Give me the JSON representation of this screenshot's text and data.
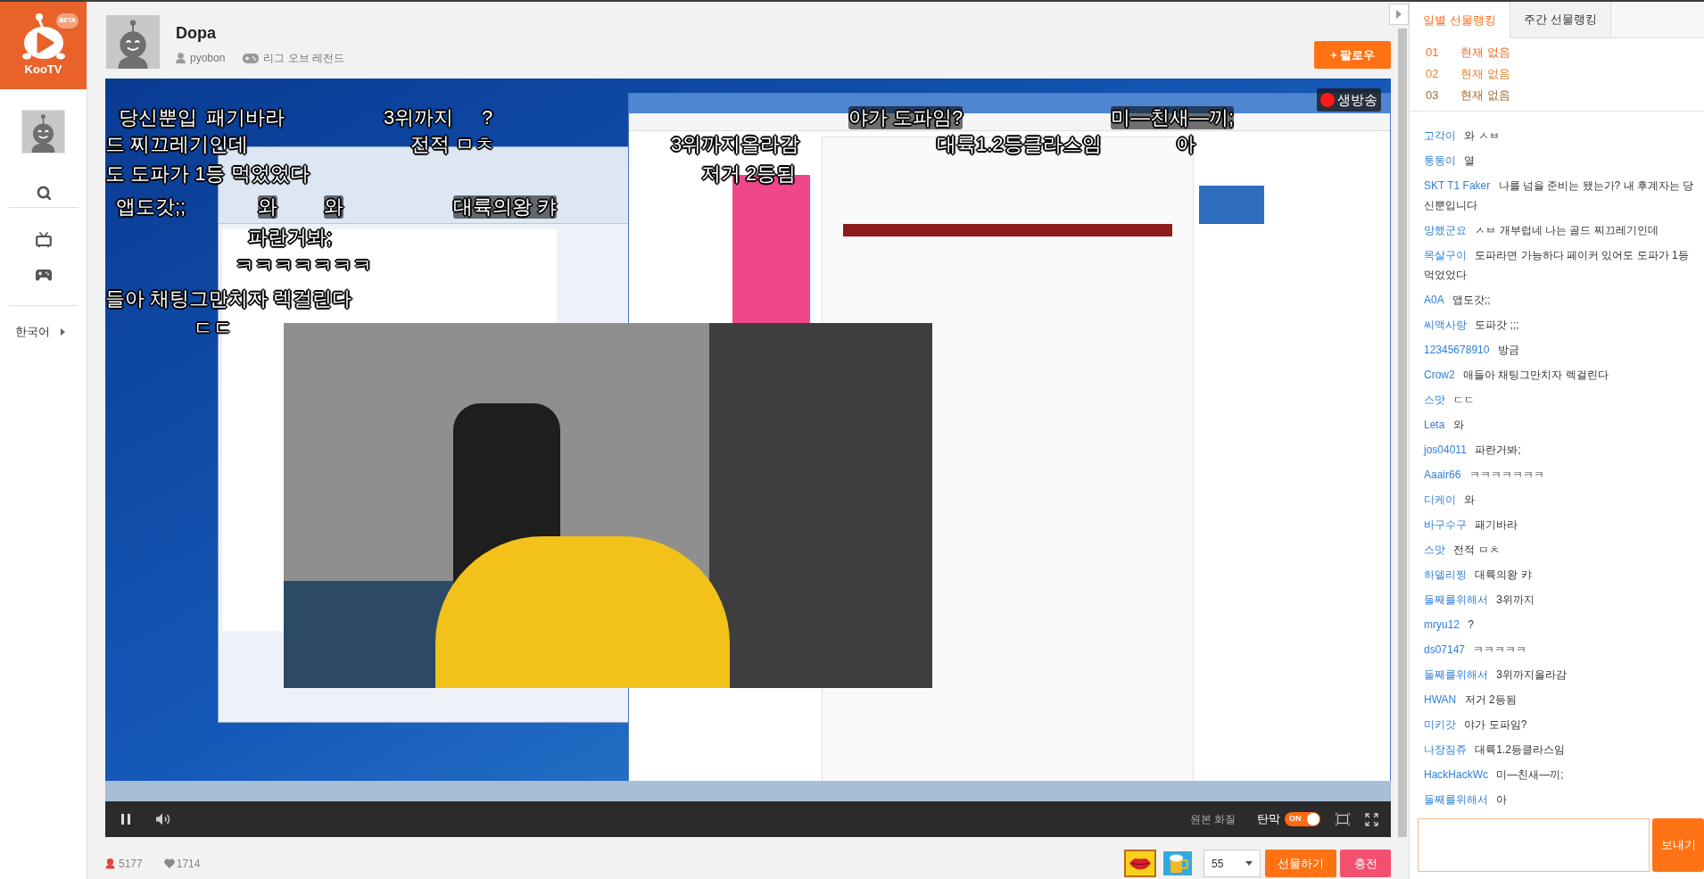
{
  "logo": {
    "name": "KooTV",
    "badge": "BETA"
  },
  "sidebar": {
    "language": "한국어"
  },
  "channel": {
    "name": "Dopa",
    "user": "pyobon",
    "game": "리그 오브 레전드",
    "follow_button": "+ 팔로우"
  },
  "player": {
    "live_badge": "생방송",
    "danmaku": [
      "당신뿐입",
      "패기바라",
      "3위까지",
      "?",
      "야가 도파임?",
      "미—친새—끼;",
      "드 찌끄레기인데",
      "전적 ㅁㅊ",
      "3위까지올라감",
      "대륙1.2등클라스임",
      "아",
      "도 도파가 1등 먹었었다",
      "저거 2등됨",
      "앱도갓;;",
      "와",
      "와",
      "대륙의왕 캬",
      "파란거봐;",
      "ㅋㅋㅋㅋㅋㅋㅋ",
      "들아 채팅그만치자 렉걸린다",
      "ㄷㄷ"
    ],
    "playing": true,
    "quality": "원본 화질",
    "danmaku_label": "탄막",
    "danmaku_toggle": {
      "label": "ON",
      "on": true
    }
  },
  "stats": {
    "viewers": "5177",
    "likes": "1714"
  },
  "gift_bar": {
    "items": [
      {
        "kind": "lips",
        "selected": true
      },
      {
        "kind": "beer",
        "selected": false
      }
    ],
    "quantity": "55",
    "gift_button": "선물하기",
    "charge_button": "충전"
  },
  "ranking": {
    "tabs": [
      {
        "label": "일별 선물랭킹",
        "selected": true
      },
      {
        "label": "주간 선물랭킹",
        "selected": false
      }
    ],
    "rows": [
      {
        "rank": "01",
        "name": "현재 없음",
        "color": "#f26d21"
      },
      {
        "rank": "02",
        "name": "현재 없음",
        "color": "#e8822f"
      },
      {
        "rank": "03",
        "name": "현재 없음",
        "color": "#a8692d"
      }
    ]
  },
  "chat": {
    "messages": [
      {
        "user": "고각이",
        "text": "와 ㅅㅂ"
      },
      {
        "user": "통통이",
        "text": "열"
      },
      {
        "user": "SKT T1 Faker",
        "text": "나를 넘을 준비는 됐는가? 내 후계자는 당신뿐입니다"
      },
      {
        "user": "망했군요",
        "text": "ㅅㅂ 개부럽네 나는 골드 찌끄레기인데"
      },
      {
        "user": "목살구이",
        "text": "도파라면 가능하다 페이커 있어도 도파가 1등 먹었었다"
      },
      {
        "user": "A0A",
        "text": "앱도갓;;"
      },
      {
        "user": "씨맥사랑",
        "text": "도파갓 ;;;"
      },
      {
        "user": "12345678910",
        "text": "방금"
      },
      {
        "user": "Crow2",
        "text": "애들아 채팅그만치자 렉걸린다"
      },
      {
        "user": "스맛",
        "text": "ㄷㄷ"
      },
      {
        "user": "Leta",
        "text": "와"
      },
      {
        "user": "jos04011",
        "text": "파란거봐;"
      },
      {
        "user": "Aaair66",
        "text": "ㅋㅋㅋㅋㅋㅋㅋ"
      },
      {
        "user": "디케이",
        "text": "와"
      },
      {
        "user": "바구수구",
        "text": "패기바라"
      },
      {
        "user": "스맛",
        "text": "전적 ㅁㅊ"
      },
      {
        "user": "하델리찡",
        "text": "대륙의왕 캬"
      },
      {
        "user": "둘째를위해서",
        "text": "3위까지"
      },
      {
        "user": "mryu12",
        "text": "?"
      },
      {
        "user": "ds07147",
        "text": "ㅋㅋㅋㅋㅋ"
      },
      {
        "user": "둘째를위해서",
        "text": "3위까지올라감"
      },
      {
        "user": "HWAN",
        "text": "저거 2등됨"
      },
      {
        "user": "미키갓",
        "text": "야가 도파임?"
      },
      {
        "user": "나장짐쥬",
        "text": "대륙1.2등클라스임"
      },
      {
        "user": "HackHackWc",
        "text": "미—친새—끼;"
      },
      {
        "user": "둘째를위해서",
        "text": "아"
      }
    ],
    "send_button": "보내기"
  }
}
